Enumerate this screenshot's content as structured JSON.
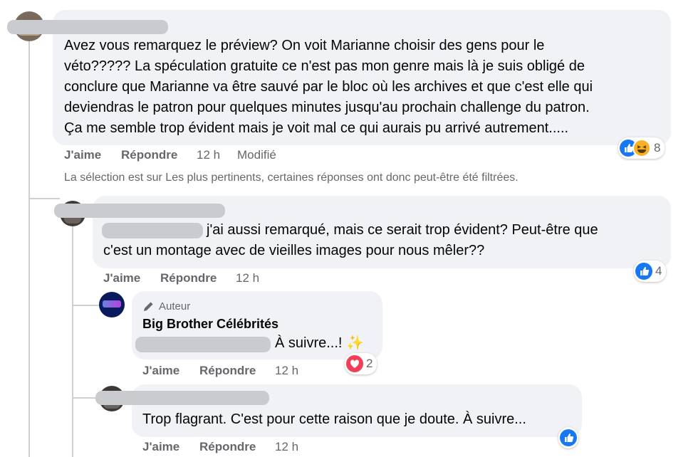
{
  "comment1": {
    "text_lines": [
      "Avez vous remarquez le préview? On voit Marianne choisir des gens pour le",
      "véto????? La spéculation gratuite ce n'est pas mon genre mais là je suis obligé de",
      "conclure que Marianne va être sauvé par le bloc où les archives et que c'est elle qui",
      "deviendras le patron pour quelques minutes jusqu'au prochain challenge du patron.",
      "Ça me semble trop évident mais je voit mal ce qui aurais pu arrivé autrement....."
    ],
    "like_label": "J'aime",
    "reply_label": "Répondre",
    "time": "12 h",
    "edited": "Modifié",
    "reaction_count": "8"
  },
  "filter_note": "La sélection est sur Les plus pertinents, certaines réponses ont donc peut-être été filtrées.",
  "reply1": {
    "text_line1": "j'ai aussi remarqué, mais ce serait trop évident? Peut-être que",
    "text_line2": "c'est un montage avec de vieilles images pour nous mêler??",
    "like_label": "J'aime",
    "reply_label": "Répondre",
    "time": "12 h",
    "reaction_count": "4"
  },
  "reply2": {
    "badge": "Auteur",
    "author": "Big Brother Célébrités",
    "text": "À suivre...! ✨",
    "like_label": "J'aime",
    "reply_label": "Répondre",
    "time": "12 h",
    "reaction_count": "2"
  },
  "reply3": {
    "text": "Trop flagrant. C'est pour cette raison que je doute. À suivre...",
    "like_label": "J'aime",
    "reply_label": "Répondre",
    "time": "12 h"
  },
  "colors": {
    "bubble": "#f0f2f5",
    "like_blue": "#1877f2",
    "love_red": "#f33e58",
    "secondary_text": "#65676b"
  }
}
